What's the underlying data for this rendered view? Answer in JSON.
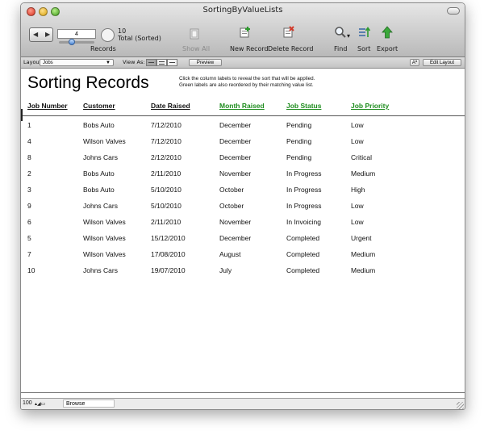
{
  "window": {
    "title": "SortingByValueLists"
  },
  "toolbar": {
    "record_value": "4",
    "total_count": "10",
    "total_label": "Total (Sorted)",
    "records_label": "Records",
    "show_all_label": "Show All",
    "new_record_label": "New Record",
    "delete_record_label": "Delete Record",
    "find_label": "Find",
    "sort_label": "Sort",
    "export_label": "Export"
  },
  "layout_bar": {
    "layout_label": "Layout:",
    "layout_value": "Jobs",
    "view_as_label": "View As:",
    "preview_label": "Preview",
    "font_btn": "Aª",
    "edit_layout_label": "Edit Layout"
  },
  "content": {
    "heading": "Sorting Records",
    "instruction_line1": "Click the column labels to reveal the sort that will be applied.",
    "instruction_line2": "Green labels are also reordered by their matching value list.",
    "columns": [
      {
        "label": "Job Number",
        "color": "black"
      },
      {
        "label": "Customer",
        "color": "black"
      },
      {
        "label": "Date Raised",
        "color": "black"
      },
      {
        "label": "Month Raised",
        "color": "green"
      },
      {
        "label": "Job Status",
        "color": "green"
      },
      {
        "label": "Job Priority",
        "color": "green"
      }
    ],
    "rows": [
      [
        "1",
        "Bobs Auto",
        "7/12/2010",
        "December",
        "Pending",
        "Low"
      ],
      [
        "4",
        "Wilson Valves",
        "7/12/2010",
        "December",
        "Pending",
        "Low"
      ],
      [
        "8",
        "Johns Cars",
        "2/12/2010",
        "December",
        "Pending",
        "Critical"
      ],
      [
        "2",
        "Bobs Auto",
        "2/11/2010",
        "November",
        "In Progress",
        "Medium"
      ],
      [
        "3",
        "Bobs Auto",
        "5/10/2010",
        "October",
        "In Progress",
        "High"
      ],
      [
        "9",
        "Johns Cars",
        "5/10/2010",
        "October",
        "In Progress",
        "Low"
      ],
      [
        "6",
        "Wilson Valves",
        "2/11/2010",
        "November",
        "In Invoicing",
        "Low"
      ],
      [
        "5",
        "Wilson Valves",
        "15/12/2010",
        "December",
        "Completed",
        "Urgent"
      ],
      [
        "7",
        "Wilson Valves",
        "17/08/2010",
        "August",
        "Completed",
        "Medium"
      ],
      [
        "10",
        "Johns Cars",
        "19/07/2010",
        "July",
        "Completed",
        "Medium"
      ]
    ]
  },
  "status_bar": {
    "zoom": "100",
    "mode": "Browse"
  },
  "colors": {
    "green_label": "#1f8d1f",
    "toolbar_top": "#e6e6e6",
    "toolbar_bottom": "#b9b9b9"
  },
  "icons": [
    "book-icon",
    "show-all-icon",
    "new-record-icon",
    "delete-record-icon",
    "find-icon",
    "sort-icon",
    "export-icon"
  ]
}
